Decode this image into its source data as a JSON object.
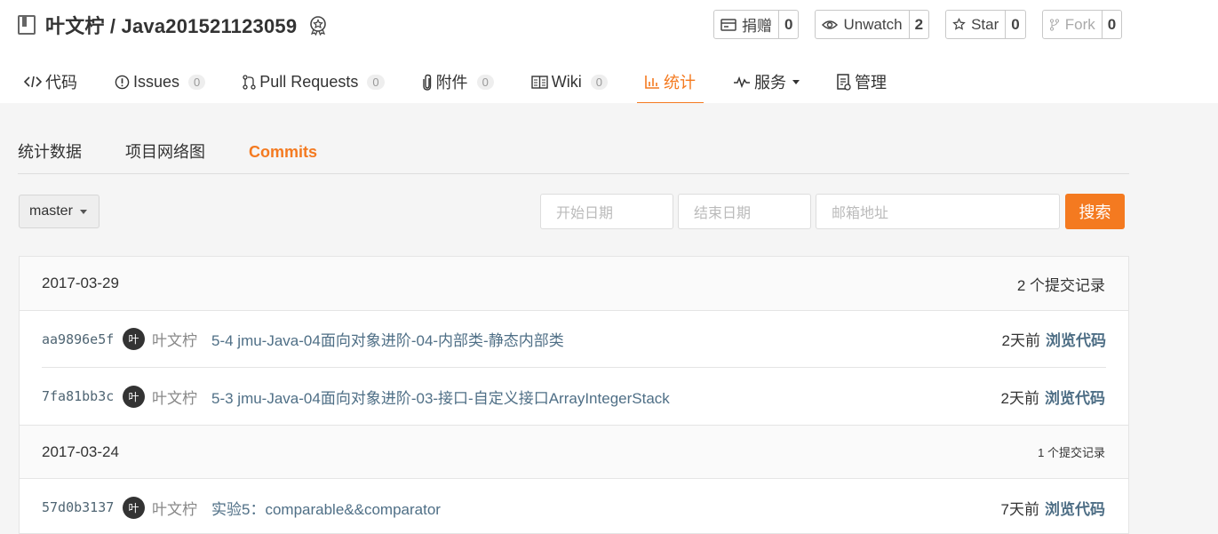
{
  "repo": {
    "title": "叶文柠 / Java201521123059"
  },
  "actions": [
    {
      "icon": "donate-icon",
      "label": "捐赠",
      "count": "0"
    },
    {
      "icon": "eye-icon",
      "label": "Unwatch",
      "count": "2"
    },
    {
      "icon": "star-icon",
      "label": "Star",
      "count": "0"
    },
    {
      "icon": "fork-icon",
      "label": "Fork",
      "count": "0"
    }
  ],
  "nav": [
    {
      "icon": "code-icon",
      "label": "代码"
    },
    {
      "icon": "issues-icon",
      "label": "Issues",
      "count": "0"
    },
    {
      "icon": "pull-request-icon",
      "label": "Pull Requests",
      "count": "0"
    },
    {
      "icon": "paperclip-icon",
      "label": "附件",
      "count": "0"
    },
    {
      "icon": "wiki-icon",
      "label": "Wiki",
      "count": "0"
    },
    {
      "icon": "chart-icon",
      "label": "统计"
    },
    {
      "icon": "pulse-icon",
      "label": "服务"
    },
    {
      "icon": "manage-icon",
      "label": "管理"
    }
  ],
  "subnav": [
    "统计数据",
    "项目网络图",
    "Commits"
  ],
  "filters": {
    "branch": "master",
    "start_placeholder": "开始日期",
    "end_placeholder": "结束日期",
    "email_placeholder": "邮箱地址",
    "search_label": "搜索"
  },
  "groups": [
    {
      "date": "2017-03-29",
      "count": "2 个提交记录",
      "commits": [
        {
          "sha": "aa9896e5f",
          "avatar": "叶",
          "author": "叶文柠",
          "message": "5-4 jmu-Java-04面向对象进阶-04-内部类-静态内部类",
          "time": "2天前",
          "browse": "浏览代码"
        },
        {
          "sha": "7fa81bb3c",
          "avatar": "叶",
          "author": "叶文柠",
          "message": "5-3 jmu-Java-04面向对象进阶-03-接口-自定义接口ArrayIntegerStack",
          "time": "2天前",
          "browse": "浏览代码"
        }
      ]
    },
    {
      "date": "2017-03-24",
      "count": "1 个提交记录",
      "commits": [
        {
          "sha": "57d0b3137",
          "avatar": "叶",
          "author": "叶文柠",
          "message": "实验5：comparable&&comparator",
          "time": "7天前",
          "browse": "浏览代码"
        }
      ]
    }
  ],
  "colors": {
    "accent": "#f47a20",
    "link": "#4f6f86"
  }
}
